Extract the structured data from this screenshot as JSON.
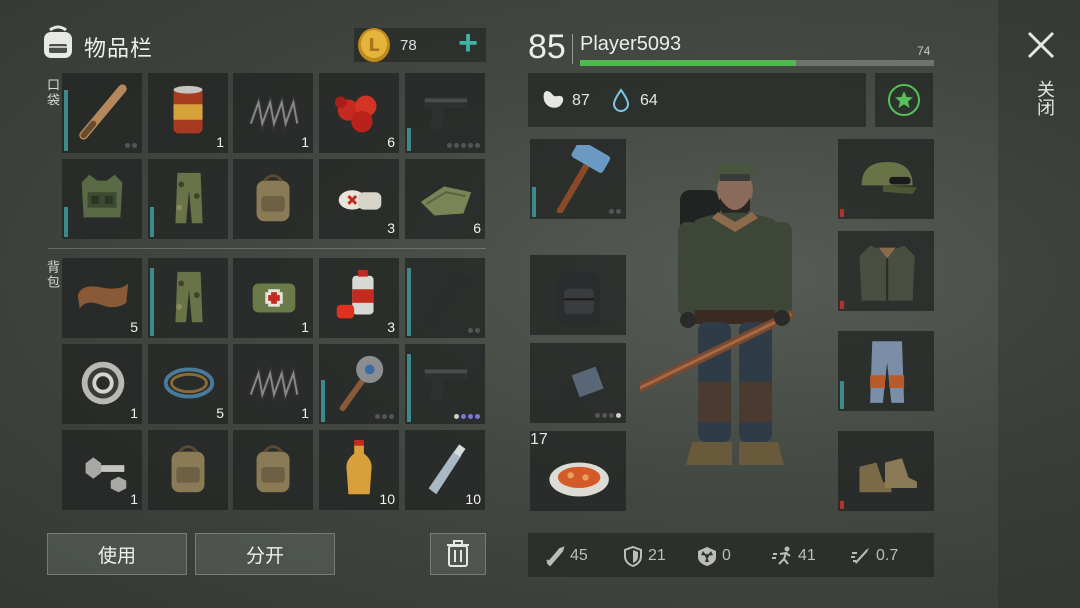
{
  "inventory": {
    "title": "物品栏",
    "coins": "78",
    "pocket_label": "口袋",
    "backpack_label": "背包",
    "pocket": [
      {
        "name": "baseball-bat",
        "count": "",
        "dots": 2,
        "bar": 80
      },
      {
        "name": "canned-food",
        "count": "1",
        "bar": 0
      },
      {
        "name": "spring",
        "count": "1",
        "bar": 0
      },
      {
        "name": "berries",
        "count": "6",
        "bar": 0
      },
      {
        "name": "pistol",
        "count": "",
        "dots": 5,
        "bar": 30
      },
      {
        "name": "armor-vest",
        "count": "",
        "bar": 40
      },
      {
        "name": "camo-pants",
        "count": "",
        "bar": 40
      },
      {
        "name": "backpack",
        "count": "",
        "bar": 0
      },
      {
        "name": "bandage",
        "count": "3",
        "bar": 0
      },
      {
        "name": "cloth",
        "count": "6",
        "bar": 0
      }
    ],
    "backpack": [
      {
        "name": "leather",
        "count": "5",
        "bar": 0
      },
      {
        "name": "camo-pants",
        "count": "",
        "bar": 90
      },
      {
        "name": "first-aid-kit",
        "count": "1",
        "bar": 0
      },
      {
        "name": "spray-paint",
        "count": "3",
        "bar": 0
      },
      {
        "name": "crowbar",
        "count": "",
        "dots": 2,
        "bar": 90
      },
      {
        "name": "bearing",
        "count": "1",
        "bar": 0
      },
      {
        "name": "wire",
        "count": "5",
        "bar": 0
      },
      {
        "name": "spring",
        "count": "1",
        "bar": 0
      },
      {
        "name": "saw-mace",
        "count": "",
        "dots": 3,
        "bar": 55
      },
      {
        "name": "pistol",
        "count": "",
        "dots": 4,
        "bar": 90
      },
      {
        "name": "bolt-nut",
        "count": "1",
        "bar": 0
      },
      {
        "name": "backpack",
        "count": "",
        "bar": 0
      },
      {
        "name": "backpack",
        "count": "",
        "bar": 0
      },
      {
        "name": "juice-bottle",
        "count": "10",
        "bar": 0
      },
      {
        "name": "water-bottle",
        "count": "10",
        "bar": 0
      }
    ],
    "use_button": "使用",
    "split_button": "分开"
  },
  "player": {
    "level": "85",
    "name": "Player5093",
    "hp": "74",
    "hp_fraction": 0.61,
    "hunger": "87",
    "thirst": "64"
  },
  "equipment_left": [
    {
      "name": "sledgehammer",
      "count": "",
      "dots": 2
    },
    {
      "name": "tactical-backpack",
      "count": ""
    },
    {
      "name": "rifle",
      "count": "",
      "dots": 4
    },
    {
      "name": "food-plate",
      "count": "17"
    }
  ],
  "equipment_right": [
    {
      "name": "cap",
      "bar_color": "#b3332a"
    },
    {
      "name": "jacket",
      "bar_color": "#b3332a"
    },
    {
      "name": "pants",
      "bar_color": "#3c8a8c"
    },
    {
      "name": "boots",
      "bar_color": "#b3332a"
    }
  ],
  "stats": {
    "attack": "45",
    "defense": "21",
    "radiation": "0",
    "speed": "41",
    "attack_speed": "0.7"
  },
  "close_label": "关闭",
  "colors": {
    "accent": "#3fb3a6",
    "hp_green": "#4fb84f",
    "durability": "#3c8a8c"
  }
}
